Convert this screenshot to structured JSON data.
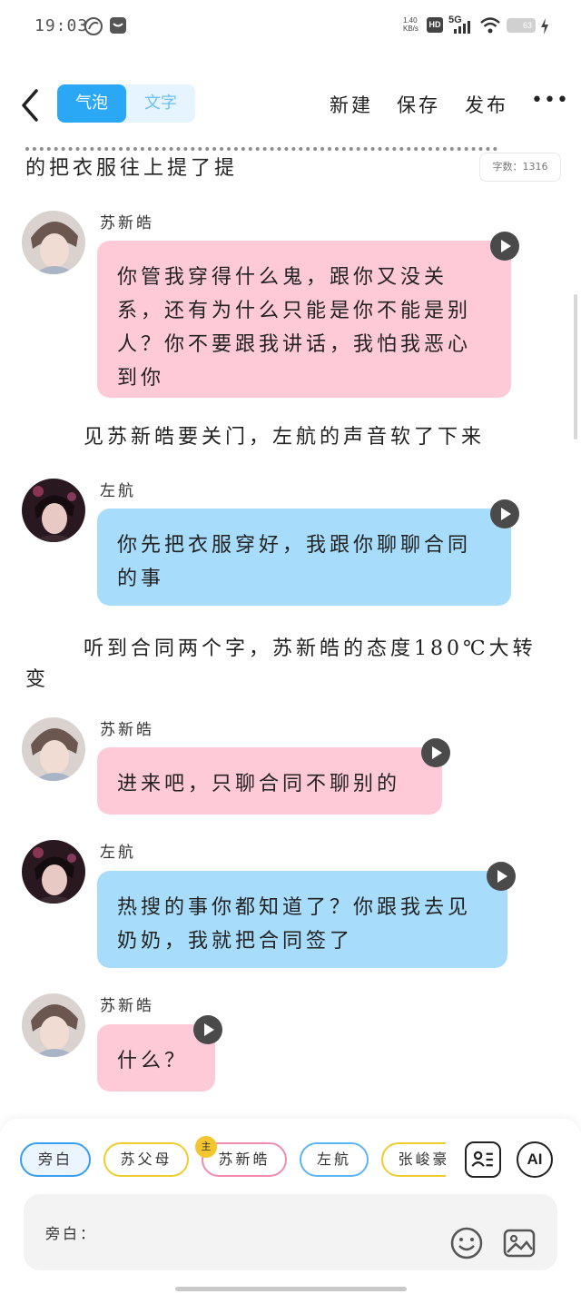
{
  "status_bar": {
    "time": "19:03",
    "net_speed": "1.40",
    "net_unit": "KB/s",
    "hd": "HD",
    "signal": "5G",
    "battery": "63"
  },
  "toolbar": {
    "tab_bubble": "气泡",
    "tab_text": "文字",
    "new_label": "新建",
    "save_label": "保存",
    "publish_label": "发布",
    "more_label": "•••"
  },
  "word_count": "字数：1316",
  "narrations": [
    "的把衣服往上提了提",
    "见苏新皓要关门，左航的声音软了下来",
    "听到合同两个字，苏新皓的态度180℃大转变"
  ],
  "messages": [
    {
      "speaker": "苏新皓",
      "text": "你管我穿得什么鬼，跟你又没关系，还有为什么只能是你不能是别人？你不要跟我讲话，我怕我恶心到你"
    },
    {
      "speaker": "左航",
      "text": "你先把衣服穿好，我跟你聊聊合同的事"
    },
    {
      "speaker": "苏新皓",
      "text": "进来吧，只聊合同不聊别的"
    },
    {
      "speaker": "左航",
      "text": "热搜的事你都知道了？你跟我去见奶奶，我就把合同签了"
    },
    {
      "speaker": "苏新皓",
      "text": "什么？"
    }
  ],
  "roles": [
    "旁白",
    "苏父母",
    "苏新皓",
    "左航",
    "张峻豪"
  ],
  "main_tag": "主",
  "ai_label": "AI",
  "input_label": "旁白："
}
